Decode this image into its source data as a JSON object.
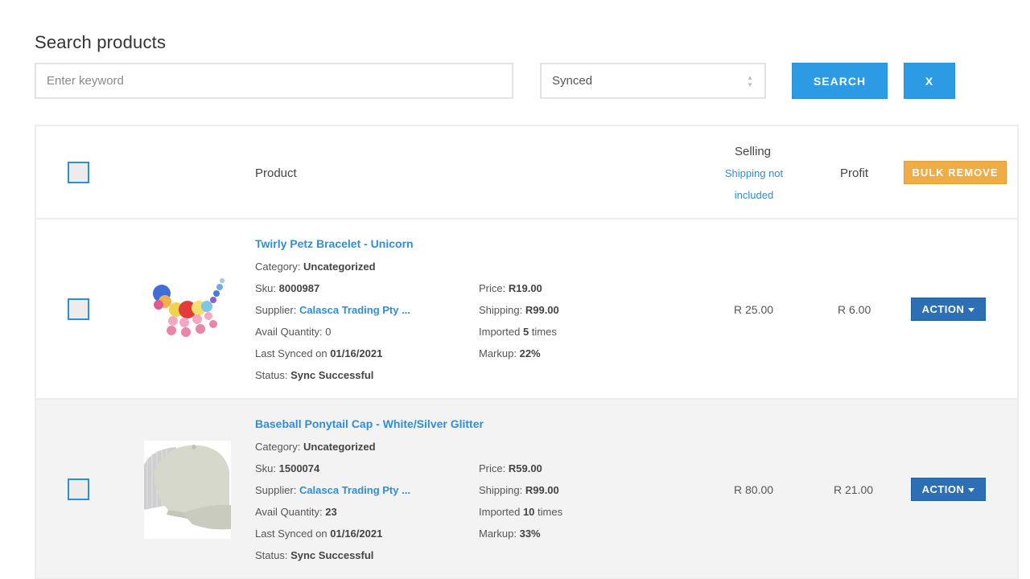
{
  "page": {
    "title": "Search products"
  },
  "search": {
    "placeholder": "Enter keyword",
    "value": "",
    "status_selected": "Synced",
    "search_label": "SEARCH",
    "clear_label": "X"
  },
  "table": {
    "headers": {
      "product": "Product",
      "selling": "Selling",
      "selling_note_line1": "Shipping not",
      "selling_note_line2": "included",
      "profit": "Profit",
      "bulk_remove": "BULK REMOVE"
    },
    "rows": [
      {
        "title": "Twirly Petz Bracelet - Unicorn",
        "category_label": "Category:",
        "category": "Uncategorized",
        "sku_label": "Sku:",
        "sku": "8000987",
        "supplier_label": "Supplier:",
        "supplier": "Calasca Trading Pty ...",
        "avail_label": "Avail Quantity:",
        "avail": "0",
        "synced_label": "Last Synced on",
        "synced": "01/16/2021",
        "status_label": "Status:",
        "status": "Sync Successful",
        "price_label": "Price:",
        "price": "R19.00",
        "shipping_label": "Shipping:",
        "shipping": "R99.00",
        "imported_prefix": "Imported",
        "imported_count": "5",
        "imported_suffix": "times",
        "markup_label": "Markup:",
        "markup": "22%",
        "selling": "R 25.00",
        "profit": "R 6.00",
        "action_label": "ACTION",
        "image_icon": "unicorn-bracelet-icon"
      },
      {
        "title": "Baseball Ponytail Cap - White/Silver Glitter",
        "category_label": "Category:",
        "category": "Uncategorized",
        "sku_label": "Sku:",
        "sku": "1500074",
        "supplier_label": "Supplier:",
        "supplier": "Calasca Trading Pty ...",
        "avail_label": "Avail Quantity:",
        "avail": "23",
        "synced_label": "Last Synced on",
        "synced": "01/16/2021",
        "status_label": "Status:",
        "status": "Sync Successful",
        "price_label": "Price:",
        "price": "R59.00",
        "shipping_label": "Shipping:",
        "shipping": "R99.00",
        "imported_prefix": "Imported",
        "imported_count": "10",
        "imported_suffix": "times",
        "markup_label": "Markup:",
        "markup": "33%",
        "selling": "R 80.00",
        "profit": "R 21.00",
        "action_label": "ACTION",
        "image_icon": "baseball-cap-icon"
      }
    ]
  },
  "colors": {
    "primary_blue": "#2d9be3",
    "link_blue": "#2d8fd8",
    "action_blue": "#2c6fb5",
    "bulk_orange": "#f0ac45",
    "row_alt": "#f3f3f3"
  }
}
